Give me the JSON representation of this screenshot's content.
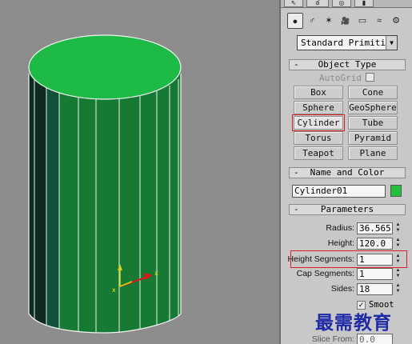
{
  "viewport": {
    "background": "#8d8d8d",
    "cylinder_color": "#1aa63c",
    "cylinder_top_color": "#1fbe46",
    "edge_color": "#ffffff"
  },
  "panel": {
    "tabs": [
      "⇖",
      "ఠ",
      "◎",
      "▮"
    ],
    "category_icons": [
      "geometry-icon",
      "shapes-icon",
      "lights-icon",
      "cameras-icon",
      "helpers-icon",
      "spacewarps-icon",
      "systems-icon"
    ],
    "category_glyphs": [
      "●",
      "♂",
      "✶",
      "🎥",
      "▭",
      "≈",
      "⚙"
    ],
    "dropdown_value": "Standard Primitiv",
    "object_type": {
      "title": "Object Type",
      "autogrid_label": "AutoGrid",
      "buttons": [
        "Box",
        "Cone",
        "Sphere",
        "GeoSphere",
        "Cylinder",
        "Tube",
        "Torus",
        "Pyramid",
        "Teapot",
        "Plane"
      ]
    },
    "name_and_color": {
      "title": "Name and Color",
      "name_value": "Cylinder01",
      "swatch_color": "#22c03c"
    },
    "parameters": {
      "title": "Parameters",
      "fields": [
        {
          "label": "Radius:",
          "value": "36.565"
        },
        {
          "label": "Height:",
          "value": "120.0"
        },
        {
          "label": "Height Segments:",
          "value": "1"
        },
        {
          "label": "Cap Segments:",
          "value": "1"
        },
        {
          "label": "Sides:",
          "value": "18"
        }
      ],
      "smooth_label": "Smoot",
      "slice_from_label": "Slice From:",
      "slice_from_value": "0.0"
    },
    "minus": "-"
  },
  "watermark": "最需教育",
  "highlight_color": "#d82020"
}
